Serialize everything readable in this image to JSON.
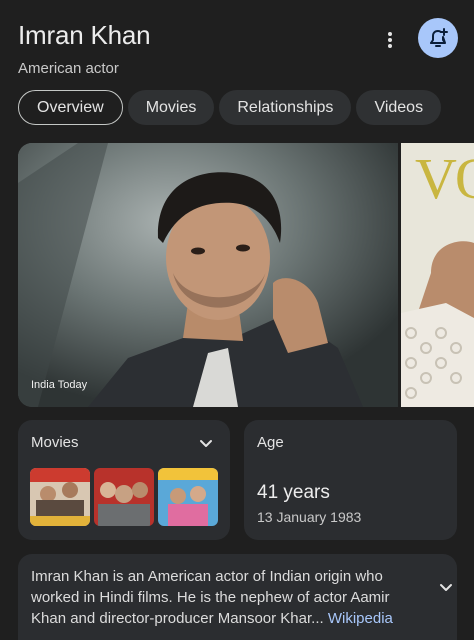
{
  "header": {
    "title": "Imran Khan",
    "subtitle": "American actor"
  },
  "tabs": [
    {
      "label": "Overview",
      "active": true
    },
    {
      "label": "Movies",
      "active": false
    },
    {
      "label": "Relationships",
      "active": false
    },
    {
      "label": "Videos",
      "active": false
    }
  ],
  "gallery": {
    "main_caption": "India Today",
    "side_text": "VO"
  },
  "movies_card": {
    "title": "Movies"
  },
  "age_card": {
    "title": "Age",
    "value": "41 years",
    "date": "13 January 1983"
  },
  "description": {
    "text": "Imran Khan is an American actor of Indian origin who worked in Hindi films. He is the nephew of actor Aamir Khan and director-producer Mansoor Khar",
    "ellipsis": "... ",
    "source": "Wikipedia"
  },
  "colors": {
    "accent": "#a8c7fa",
    "background": "#1f1f1f",
    "card": "#2b2d30"
  },
  "icons": {
    "more": "more-vert-icon",
    "bell": "bell-add-icon",
    "chevron": "chevron-down-icon"
  }
}
